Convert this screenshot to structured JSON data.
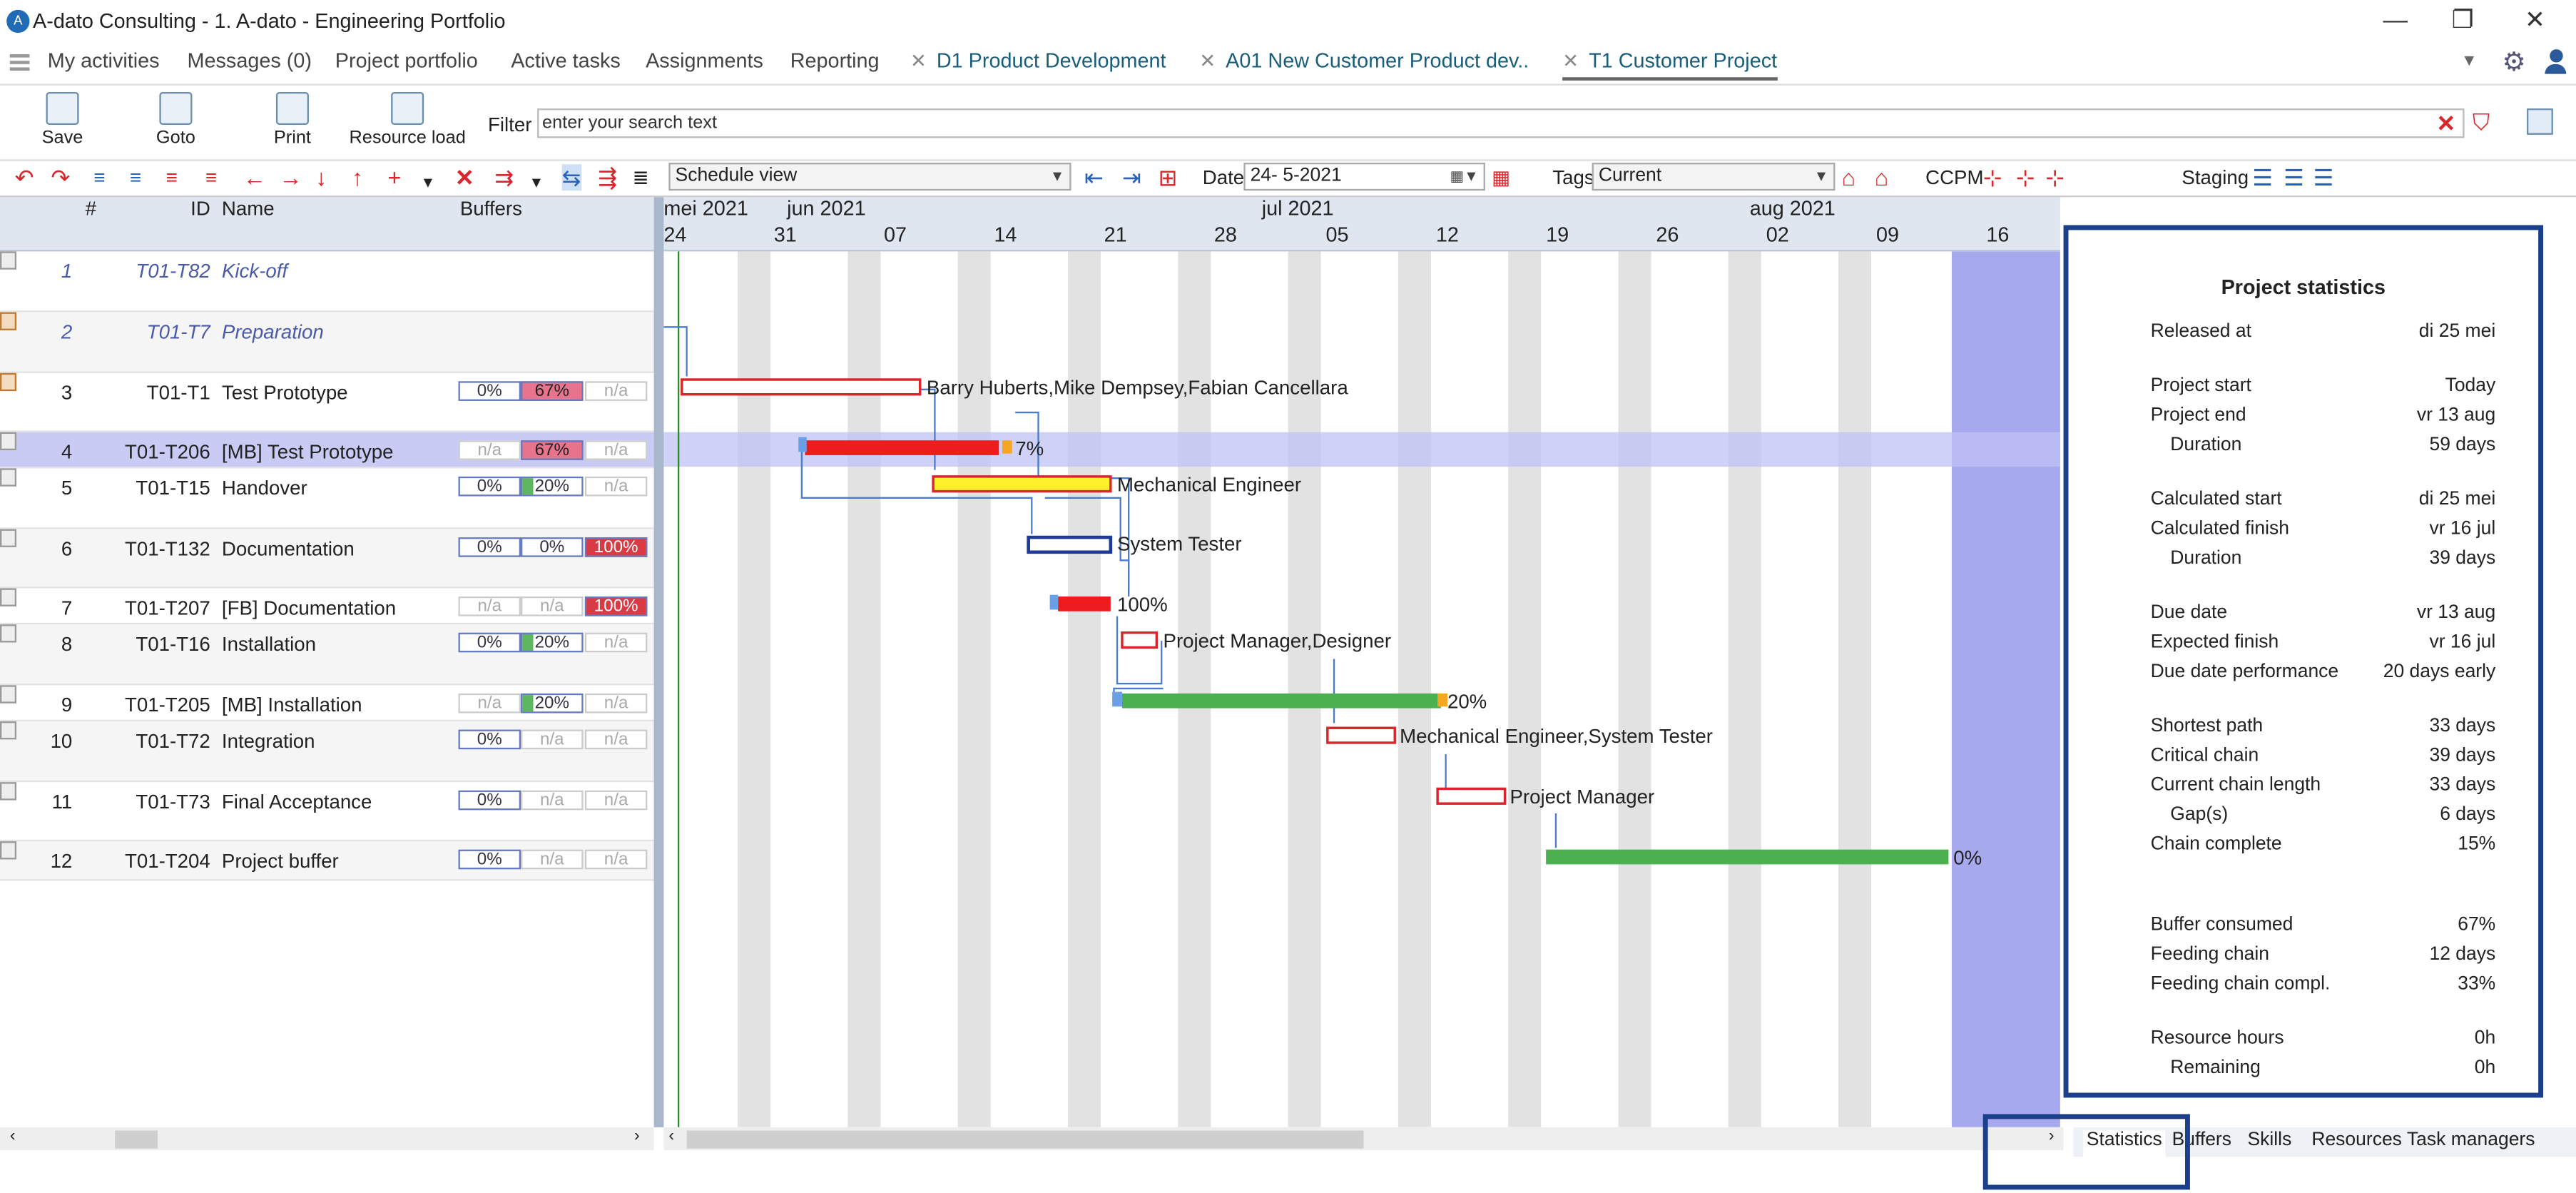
{
  "window": {
    "title": "A-dato Consulting - 1. A-dato - Engineering Portfolio",
    "logo": "A",
    "min": "—",
    "restore": "❐",
    "close": "✕"
  },
  "tabs": [
    {
      "label": "My activities"
    },
    {
      "label": "Messages (0)"
    },
    {
      "label": "Project portfolio"
    },
    {
      "label": "Active tasks"
    },
    {
      "label": "Assignments"
    },
    {
      "label": "Reporting"
    },
    {
      "label": "D1 Product Development",
      "closable": "✕"
    },
    {
      "label": "A01  New Customer Product dev..",
      "closable": "✕"
    },
    {
      "label": "T1 Customer Project",
      "closable": "✕"
    }
  ],
  "toolbar": {
    "save": "Save",
    "goto": "Goto",
    "print": "Print",
    "resource_load": "Resource load",
    "filter_label": "Filter",
    "filter_placeholder": "enter your search text"
  },
  "toolbar2": {
    "view": "Schedule view",
    "date_label": "Date",
    "date": "24- 5-2021",
    "tags_label": "Tags",
    "tags": "Current",
    "ccpm": "CCPM",
    "staging": "Staging"
  },
  "grid": {
    "headers": {
      "num": "#",
      "id": "ID",
      "name": "Name",
      "buffers": "Buffers"
    },
    "rows": [
      {
        "n": "1",
        "id": "T01-T82",
        "name": "Kick-off",
        "b": [
          "",
          "",
          ""
        ]
      },
      {
        "n": "2",
        "id": "T01-T7",
        "name": "Preparation",
        "b": [
          "",
          "",
          ""
        ]
      },
      {
        "n": "3",
        "id": "T01-T1",
        "name": "Test Prototype",
        "b": [
          "0%",
          "67%",
          "n/a"
        ]
      },
      {
        "n": "4",
        "id": "T01-T206",
        "name": "[MB]  Test Prototype",
        "b": [
          "n/a",
          "67%",
          "n/a"
        ]
      },
      {
        "n": "5",
        "id": "T01-T15",
        "name": "Handover",
        "b": [
          "0%",
          "20%",
          "n/a"
        ]
      },
      {
        "n": "6",
        "id": "T01-T132",
        "name": "Documentation",
        "b": [
          "0%",
          "0%",
          "100%"
        ]
      },
      {
        "n": "7",
        "id": "T01-T207",
        "name": "[FB]  Documentation",
        "b": [
          "n/a",
          "n/a",
          "100%"
        ]
      },
      {
        "n": "8",
        "id": "T01-T16",
        "name": "Installation",
        "b": [
          "0%",
          "20%",
          "n/a"
        ]
      },
      {
        "n": "9",
        "id": "T01-T205",
        "name": "[MB]  Installation",
        "b": [
          "n/a",
          "20%",
          "n/a"
        ]
      },
      {
        "n": "10",
        "id": "T01-T72",
        "name": "Integration",
        "b": [
          "0%",
          "n/a",
          "n/a"
        ]
      },
      {
        "n": "11",
        "id": "T01-T73",
        "name": "Final Acceptance",
        "b": [
          "0%",
          "n/a",
          "n/a"
        ]
      },
      {
        "n": "12",
        "id": "T01-T204",
        "name": "Project buffer",
        "b": [
          "0%",
          "n/a",
          "n/a"
        ]
      }
    ]
  },
  "gantt": {
    "months": [
      "mei 2021",
      "jun 2021",
      "jul 2021",
      "aug 2021"
    ],
    "days": [
      "24",
      "31",
      "07",
      "14",
      "21",
      "28",
      "05",
      "12",
      "19",
      "26",
      "02",
      "09",
      "16"
    ],
    "labels": [
      "Barry Huberts,Mike Dempsey,Fabian Cancellara",
      "7%",
      "Mechanical Engineer",
      "System Tester",
      "100%",
      "Project Manager,Designer",
      "20%",
      "Mechanical Engineer,System Tester",
      "Project Manager",
      "0%"
    ]
  },
  "stats": {
    "title": "Project statistics",
    "items": [
      {
        "l": "Released at",
        "v": "di 25 mei"
      },
      {
        "l": "Project start",
        "v": "Today"
      },
      {
        "l": "Project end",
        "v": "vr 13 aug"
      },
      {
        "l": "Duration",
        "v": "59 days"
      },
      {
        "l": "Calculated start",
        "v": "di 25 mei"
      },
      {
        "l": "Calculated finish",
        "v": "vr 16 jul"
      },
      {
        "l": "Duration",
        "v": "39 days"
      },
      {
        "l": "Due date",
        "v": "vr 13 aug"
      },
      {
        "l": "Expected finish",
        "v": "vr 16 jul"
      },
      {
        "l": "Due date performance",
        "v": "20 days early"
      },
      {
        "l": "Shortest path",
        "v": "33 days"
      },
      {
        "l": "Critical chain",
        "v": "39 days"
      },
      {
        "l": "Current chain length",
        "v": "33 days"
      },
      {
        "l": "Gap(s)",
        "v": "6 days"
      },
      {
        "l": "Chain complete",
        "v": "15%"
      },
      {
        "l": "Buffer consumed",
        "v": "67%"
      },
      {
        "l": "Feeding chain",
        "v": "12 days"
      },
      {
        "l": "Feeding chain compl.",
        "v": "33%"
      },
      {
        "l": "Resource hours",
        "v": "0h"
      },
      {
        "l": "Remaining",
        "v": "0h"
      }
    ]
  },
  "bottom_tabs": [
    "Statistics",
    "Buffers",
    "Skills",
    "Resources",
    "Task managers"
  ]
}
